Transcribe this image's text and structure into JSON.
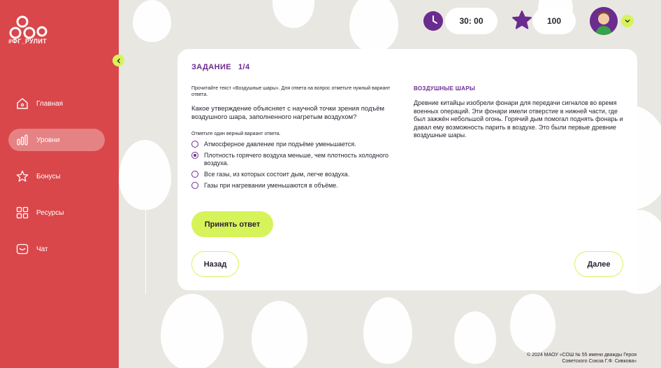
{
  "app": {
    "logo_text": "#ФГ_РУЛИТ"
  },
  "sidebar": {
    "items": [
      {
        "label": "Главная",
        "icon": "home-icon"
      },
      {
        "label": "Уровни",
        "icon": "levels-icon",
        "active": true
      },
      {
        "label": "Бонусы",
        "icon": "star-icon"
      },
      {
        "label": "Ресурсы",
        "icon": "grid-icon"
      },
      {
        "label": "Чат",
        "icon": "chat-icon"
      }
    ]
  },
  "topbar": {
    "timer": "30: 00",
    "score": "100"
  },
  "task": {
    "title": "ЗАДАНИЕ",
    "progress": "1/4",
    "instruction": "Прочитайте текст «Воздушные шары». Для ответа на вопрос отметьте нужный вариант ответа.",
    "question": "Какое утверждение объясняет с научной точки зрения подъём воздушного шара, заполненного нагретым воздухом?",
    "sub_instruction": "Отметьте один верный вариант ответа.",
    "options": [
      {
        "label": "Атмосферное давление при подъёме уменьшается.",
        "checked": false
      },
      {
        "label": "Плотность горячего воздуха меньше, чем плотность холодного воздуха.",
        "checked": true
      },
      {
        "label": "Все газы, из которых состоит дым, легче воздуха.",
        "checked": false
      },
      {
        "label": "Газы при нагревании уменьшаются в объёме.",
        "checked": false
      }
    ],
    "submit_label": "Принять ответ",
    "back_label": "Назад",
    "next_label": "Далее",
    "text_title": "ВОЗДУШНЫЕ ШАРЫ",
    "text_body": "Древние китайцы изобрели фонари для передачи сигналов во время военных операций. Эти фонари имели отверстие в нижней части, где был зажжён небольшой огонь. Горячий дым помогал поднять фонарь и давал ему возможность парить в воздухе. Это были первые древние воздушные шары."
  },
  "footer": {
    "line1": "© 2024 МАОУ «СОШ № 55 имени дважды Героя",
    "line2": "Советского Союза Г.Ф. Сивкова»"
  },
  "colors": {
    "sidebar": "#d9474b",
    "accent": "#d7f35a",
    "purple": "#6b2c8f",
    "background": "#e9e7e2"
  }
}
